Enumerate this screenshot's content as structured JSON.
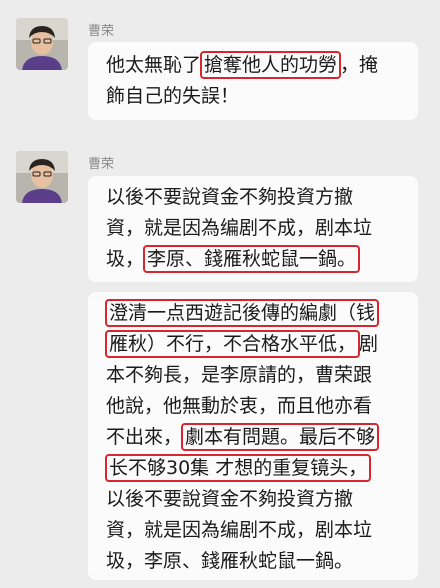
{
  "messages": [
    {
      "sender": "曹荣",
      "lines": [
        {
          "pre": "他太無恥了",
          "hl": "搶奪他人的功勞",
          "post": "，掩"
        },
        {
          "pre": "飾自己的失誤！",
          "hl": "",
          "post": ""
        }
      ]
    },
    {
      "sender": "曹荣",
      "lines": [
        {
          "pre": "以後不要說資金不夠投資方撤",
          "hl": "",
          "post": ""
        },
        {
          "pre": "資，就是因為编剧不成，剧本垃",
          "hl": "",
          "post": ""
        },
        {
          "pre": "圾，",
          "hl": "李原、錢雁秋蛇鼠一鍋。",
          "post": ""
        }
      ]
    },
    {
      "sender": "",
      "lines": [
        {
          "pre": "",
          "hl": "澄清一点西遊記後傳的編劇（钱",
          "post": ""
        },
        {
          "pre": "",
          "hl": "雁秋）不行，不合格水平低，",
          "post": "剧"
        },
        {
          "pre": "本不夠長，是李原請的，曹荣跟",
          "hl": "",
          "post": ""
        },
        {
          "pre": "他說，他無動於衷，而且他亦看",
          "hl": "",
          "post": ""
        },
        {
          "pre": "不出來，",
          "hl": "劇本有問題。最后不够",
          "post": ""
        },
        {
          "pre": "",
          "hl": "长不够30集 才想的重复镜头，",
          "post": ""
        },
        {
          "pre": "以後不要說資金不夠投資方撤",
          "hl": "",
          "post": ""
        },
        {
          "pre": "資，就是因為编剧不成，剧本垃",
          "hl": "",
          "post": ""
        },
        {
          "pre": "圾，李原、錢雁秋蛇鼠一鍋。",
          "hl": "",
          "post": ""
        }
      ]
    }
  ]
}
